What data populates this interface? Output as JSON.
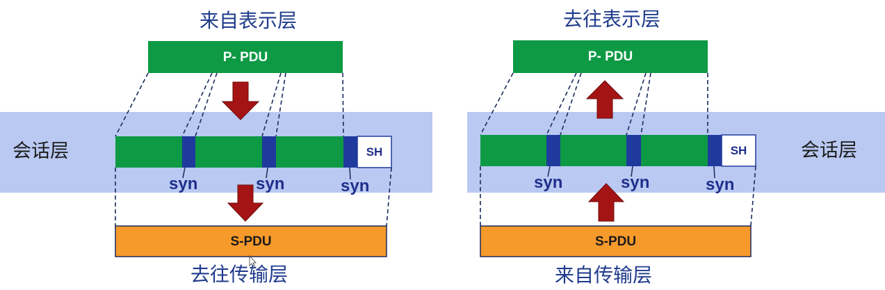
{
  "left": {
    "top_title": "来自表示层",
    "bottom_title": "去往传输层",
    "layer_label": "会话层",
    "p_pdu": "P- PDU",
    "s_pdu": "S-PDU",
    "sh": "SH",
    "syn_labels": [
      "syn",
      "syn",
      "syn"
    ]
  },
  "right": {
    "top_title": "去往表示层",
    "bottom_title": "来自传输层",
    "layer_label": "会话层",
    "p_pdu": "P- PDU",
    "s_pdu": "S-PDU",
    "sh": "SH",
    "syn_labels": [
      "syn",
      "syn",
      "syn"
    ]
  },
  "colors": {
    "band": "#b9c9f2",
    "green": "#0e9a45",
    "orange": "#f79a2c",
    "syn_block": "#1f3a9c",
    "arrow": "#a51414",
    "title_text": "#1f3b8c"
  }
}
